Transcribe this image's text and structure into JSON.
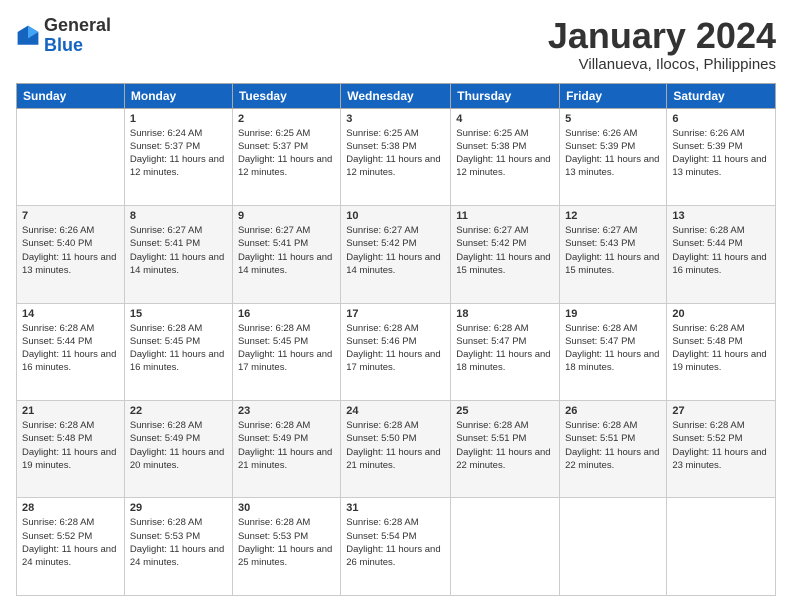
{
  "header": {
    "logo_general": "General",
    "logo_blue": "Blue",
    "month_title": "January 2024",
    "location": "Villanueva, Ilocos, Philippines"
  },
  "days_of_week": [
    "Sunday",
    "Monday",
    "Tuesday",
    "Wednesday",
    "Thursday",
    "Friday",
    "Saturday"
  ],
  "weeks": [
    [
      {
        "day": "",
        "sunrise": "",
        "sunset": "",
        "daylight": ""
      },
      {
        "day": "1",
        "sunrise": "Sunrise: 6:24 AM",
        "sunset": "Sunset: 5:37 PM",
        "daylight": "Daylight: 11 hours and 12 minutes."
      },
      {
        "day": "2",
        "sunrise": "Sunrise: 6:25 AM",
        "sunset": "Sunset: 5:37 PM",
        "daylight": "Daylight: 11 hours and 12 minutes."
      },
      {
        "day": "3",
        "sunrise": "Sunrise: 6:25 AM",
        "sunset": "Sunset: 5:38 PM",
        "daylight": "Daylight: 11 hours and 12 minutes."
      },
      {
        "day": "4",
        "sunrise": "Sunrise: 6:25 AM",
        "sunset": "Sunset: 5:38 PM",
        "daylight": "Daylight: 11 hours and 12 minutes."
      },
      {
        "day": "5",
        "sunrise": "Sunrise: 6:26 AM",
        "sunset": "Sunset: 5:39 PM",
        "daylight": "Daylight: 11 hours and 13 minutes."
      },
      {
        "day": "6",
        "sunrise": "Sunrise: 6:26 AM",
        "sunset": "Sunset: 5:39 PM",
        "daylight": "Daylight: 11 hours and 13 minutes."
      }
    ],
    [
      {
        "day": "7",
        "sunrise": "Sunrise: 6:26 AM",
        "sunset": "Sunset: 5:40 PM",
        "daylight": "Daylight: 11 hours and 13 minutes."
      },
      {
        "day": "8",
        "sunrise": "Sunrise: 6:27 AM",
        "sunset": "Sunset: 5:41 PM",
        "daylight": "Daylight: 11 hours and 14 minutes."
      },
      {
        "day": "9",
        "sunrise": "Sunrise: 6:27 AM",
        "sunset": "Sunset: 5:41 PM",
        "daylight": "Daylight: 11 hours and 14 minutes."
      },
      {
        "day": "10",
        "sunrise": "Sunrise: 6:27 AM",
        "sunset": "Sunset: 5:42 PM",
        "daylight": "Daylight: 11 hours and 14 minutes."
      },
      {
        "day": "11",
        "sunrise": "Sunrise: 6:27 AM",
        "sunset": "Sunset: 5:42 PM",
        "daylight": "Daylight: 11 hours and 15 minutes."
      },
      {
        "day": "12",
        "sunrise": "Sunrise: 6:27 AM",
        "sunset": "Sunset: 5:43 PM",
        "daylight": "Daylight: 11 hours and 15 minutes."
      },
      {
        "day": "13",
        "sunrise": "Sunrise: 6:28 AM",
        "sunset": "Sunset: 5:44 PM",
        "daylight": "Daylight: 11 hours and 16 minutes."
      }
    ],
    [
      {
        "day": "14",
        "sunrise": "Sunrise: 6:28 AM",
        "sunset": "Sunset: 5:44 PM",
        "daylight": "Daylight: 11 hours and 16 minutes."
      },
      {
        "day": "15",
        "sunrise": "Sunrise: 6:28 AM",
        "sunset": "Sunset: 5:45 PM",
        "daylight": "Daylight: 11 hours and 16 minutes."
      },
      {
        "day": "16",
        "sunrise": "Sunrise: 6:28 AM",
        "sunset": "Sunset: 5:45 PM",
        "daylight": "Daylight: 11 hours and 17 minutes."
      },
      {
        "day": "17",
        "sunrise": "Sunrise: 6:28 AM",
        "sunset": "Sunset: 5:46 PM",
        "daylight": "Daylight: 11 hours and 17 minutes."
      },
      {
        "day": "18",
        "sunrise": "Sunrise: 6:28 AM",
        "sunset": "Sunset: 5:47 PM",
        "daylight": "Daylight: 11 hours and 18 minutes."
      },
      {
        "day": "19",
        "sunrise": "Sunrise: 6:28 AM",
        "sunset": "Sunset: 5:47 PM",
        "daylight": "Daylight: 11 hours and 18 minutes."
      },
      {
        "day": "20",
        "sunrise": "Sunrise: 6:28 AM",
        "sunset": "Sunset: 5:48 PM",
        "daylight": "Daylight: 11 hours and 19 minutes."
      }
    ],
    [
      {
        "day": "21",
        "sunrise": "Sunrise: 6:28 AM",
        "sunset": "Sunset: 5:48 PM",
        "daylight": "Daylight: 11 hours and 19 minutes."
      },
      {
        "day": "22",
        "sunrise": "Sunrise: 6:28 AM",
        "sunset": "Sunset: 5:49 PM",
        "daylight": "Daylight: 11 hours and 20 minutes."
      },
      {
        "day": "23",
        "sunrise": "Sunrise: 6:28 AM",
        "sunset": "Sunset: 5:49 PM",
        "daylight": "Daylight: 11 hours and 21 minutes."
      },
      {
        "day": "24",
        "sunrise": "Sunrise: 6:28 AM",
        "sunset": "Sunset: 5:50 PM",
        "daylight": "Daylight: 11 hours and 21 minutes."
      },
      {
        "day": "25",
        "sunrise": "Sunrise: 6:28 AM",
        "sunset": "Sunset: 5:51 PM",
        "daylight": "Daylight: 11 hours and 22 minutes."
      },
      {
        "day": "26",
        "sunrise": "Sunrise: 6:28 AM",
        "sunset": "Sunset: 5:51 PM",
        "daylight": "Daylight: 11 hours and 22 minutes."
      },
      {
        "day": "27",
        "sunrise": "Sunrise: 6:28 AM",
        "sunset": "Sunset: 5:52 PM",
        "daylight": "Daylight: 11 hours and 23 minutes."
      }
    ],
    [
      {
        "day": "28",
        "sunrise": "Sunrise: 6:28 AM",
        "sunset": "Sunset: 5:52 PM",
        "daylight": "Daylight: 11 hours and 24 minutes."
      },
      {
        "day": "29",
        "sunrise": "Sunrise: 6:28 AM",
        "sunset": "Sunset: 5:53 PM",
        "daylight": "Daylight: 11 hours and 24 minutes."
      },
      {
        "day": "30",
        "sunrise": "Sunrise: 6:28 AM",
        "sunset": "Sunset: 5:53 PM",
        "daylight": "Daylight: 11 hours and 25 minutes."
      },
      {
        "day": "31",
        "sunrise": "Sunrise: 6:28 AM",
        "sunset": "Sunset: 5:54 PM",
        "daylight": "Daylight: 11 hours and 26 minutes."
      },
      {
        "day": "",
        "sunrise": "",
        "sunset": "",
        "daylight": ""
      },
      {
        "day": "",
        "sunrise": "",
        "sunset": "",
        "daylight": ""
      },
      {
        "day": "",
        "sunrise": "",
        "sunset": "",
        "daylight": ""
      }
    ]
  ]
}
